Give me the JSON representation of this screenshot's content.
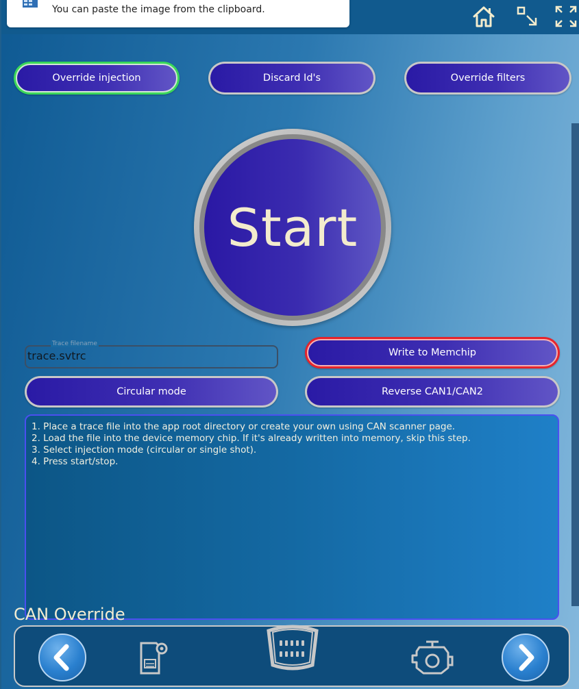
{
  "toast": {
    "message": "You can paste the image from the clipboard.",
    "icon": "clipboard-image-icon"
  },
  "topbar": {
    "icons": [
      "home-icon",
      "minimize-icon",
      "fullscreen-icon"
    ]
  },
  "modes": {
    "override_injection": "Override injection",
    "discard_ids": "Discard Id's",
    "override_filters": "Override filters"
  },
  "start": {
    "label": "Start"
  },
  "trace": {
    "field_label": "Trace filename",
    "value": "trace.svtrc"
  },
  "actions": {
    "write_memchip": "Write to Memchip",
    "circular_mode": "Circular mode",
    "reverse_can": "Reverse CAN1/CAN2"
  },
  "instructions": {
    "lines": [
      "1. Place a trace file into the app root directory or create your own using CAN scanner page.",
      " 2. Load the file into the device memory chip. If it's already written into memory, skip this step.",
      " 3. Select injection mode (circular or single shot).",
      " 4. Press start/stop."
    ]
  },
  "footer": {
    "title": "CAN Override",
    "icons": [
      "previous-arrow-icon",
      "memory-card-settings-icon",
      "obd-connector-icon",
      "engine-icon",
      "next-arrow-icon"
    ]
  },
  "colors": {
    "button_gradient_start": "#2a1aa5",
    "button_gradient_end": "#6155c6",
    "active_green": "#3bd95a",
    "active_red": "#e6242b",
    "start_text": "#f3eccd"
  }
}
